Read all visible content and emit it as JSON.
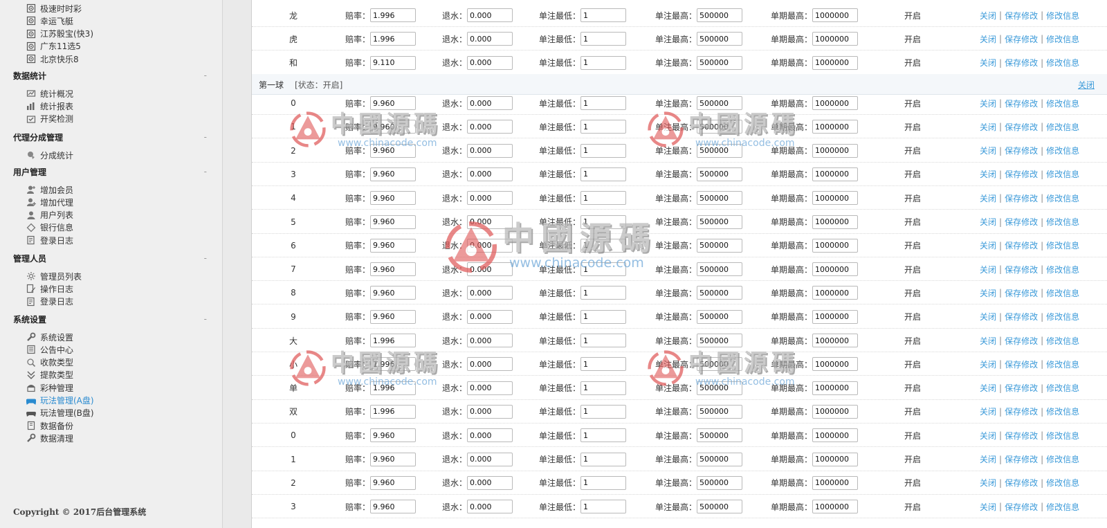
{
  "sidebar": {
    "top_items": [
      {
        "label": "极速时时彩",
        "icon": "lottery-icon"
      },
      {
        "label": "幸运飞艇",
        "icon": "lottery-icon"
      },
      {
        "label": "江苏骰宝(快3)",
        "icon": "lottery-icon"
      },
      {
        "label": "广东11选5",
        "icon": "lottery-icon"
      },
      {
        "label": "北京快乐8",
        "icon": "lottery-icon"
      }
    ],
    "sections": [
      {
        "title": "数据统计",
        "toggle": "-",
        "items": [
          {
            "label": "统计概况",
            "icon": "chart-icon"
          },
          {
            "label": "统计报表",
            "icon": "report-icon"
          },
          {
            "label": "开奖检测",
            "icon": "check-icon"
          }
        ]
      },
      {
        "title": "代理分成管理",
        "toggle": "-",
        "items": [
          {
            "label": "分成统计",
            "icon": "pie-icon"
          }
        ]
      },
      {
        "title": "用户管理",
        "toggle": "-",
        "items": [
          {
            "label": "增加会员",
            "icon": "add-user-icon"
          },
          {
            "label": "增加代理",
            "icon": "add-agent-icon"
          },
          {
            "label": "用户列表",
            "icon": "user-icon"
          },
          {
            "label": "银行信息",
            "icon": "bank-icon"
          },
          {
            "label": "登录日志",
            "icon": "log-icon"
          }
        ]
      },
      {
        "title": "管理人员",
        "toggle": "-",
        "items": [
          {
            "label": "管理员列表",
            "icon": "gear-icon"
          },
          {
            "label": "操作日志",
            "icon": "edit-log-icon"
          },
          {
            "label": "登录日志",
            "icon": "log-icon"
          }
        ]
      },
      {
        "title": "系统设置",
        "toggle": "-",
        "items": [
          {
            "label": "系统设置",
            "icon": "wrench-icon"
          },
          {
            "label": "公告中心",
            "icon": "notice-icon"
          },
          {
            "label": "收款类型",
            "icon": "receive-icon"
          },
          {
            "label": "提款类型",
            "icon": "withdraw-icon"
          },
          {
            "label": "彩种管理",
            "icon": "lottery-type-icon"
          },
          {
            "label": "玩法管理(A盘)",
            "icon": "gamepad-icon",
            "active": true
          },
          {
            "label": "玩法管理(B盘)",
            "icon": "gamepad-icon"
          },
          {
            "label": "数据备份",
            "icon": "backup-icon"
          },
          {
            "label": "数据清理",
            "icon": "wrench-icon"
          }
        ]
      }
    ],
    "copyright": "Copyright © 2017后台管理系统"
  },
  "labels": {
    "odds": "赔率：",
    "rebate": "退水：",
    "min_bet": "单注最低：",
    "max_bet": "单注最高：",
    "period_max": "单期最高：",
    "status_open": "开启",
    "op_close": "关闭",
    "op_save": "保存修改",
    "op_edit": "修改信息",
    "sep": "|"
  },
  "top_rows": [
    {
      "name": "龙",
      "odds": "1.996",
      "rebate": "0.000",
      "min": "1",
      "max": "500000",
      "period_max": "1000000",
      "status": "开启"
    },
    {
      "name": "虎",
      "odds": "1.996",
      "rebate": "0.000",
      "min": "1",
      "max": "500000",
      "period_max": "1000000",
      "status": "开启"
    },
    {
      "name": "和",
      "odds": "9.110",
      "rebate": "0.000",
      "min": "1",
      "max": "500000",
      "period_max": "1000000",
      "status": "开启"
    }
  ],
  "group": {
    "title": "第一球",
    "status": "[状态：开启]",
    "close": "关闭"
  },
  "group_rows": [
    {
      "name": "0",
      "odds": "9.960",
      "rebate": "0.000",
      "min": "1",
      "max": "500000",
      "period_max": "1000000",
      "status": "开启"
    },
    {
      "name": "1",
      "odds": "9.960",
      "rebate": "0.000",
      "min": "1",
      "max": "500000",
      "period_max": "1000000",
      "status": "开启"
    },
    {
      "name": "2",
      "odds": "9.960",
      "rebate": "0.000",
      "min": "1",
      "max": "500000",
      "period_max": "1000000",
      "status": "开启"
    },
    {
      "name": "3",
      "odds": "9.960",
      "rebate": "0.000",
      "min": "1",
      "max": "500000",
      "period_max": "1000000",
      "status": "开启"
    },
    {
      "name": "4",
      "odds": "9.960",
      "rebate": "0.000",
      "min": "1",
      "max": "500000",
      "period_max": "1000000",
      "status": "开启"
    },
    {
      "name": "5",
      "odds": "9.960",
      "rebate": "0.000",
      "min": "1",
      "max": "500000",
      "period_max": "1000000",
      "status": "开启"
    },
    {
      "name": "6",
      "odds": "9.960",
      "rebate": "0.000",
      "min": "1",
      "max": "500000",
      "period_max": "1000000",
      "status": "开启"
    },
    {
      "name": "7",
      "odds": "9.960",
      "rebate": "0.000",
      "min": "1",
      "max": "500000",
      "period_max": "1000000",
      "status": "开启"
    },
    {
      "name": "8",
      "odds": "9.960",
      "rebate": "0.000",
      "min": "1",
      "max": "500000",
      "period_max": "1000000",
      "status": "开启"
    },
    {
      "name": "9",
      "odds": "9.960",
      "rebate": "0.000",
      "min": "1",
      "max": "500000",
      "period_max": "1000000",
      "status": "开启"
    },
    {
      "name": "大",
      "odds": "1.996",
      "rebate": "0.000",
      "min": "1",
      "max": "500000",
      "period_max": "1000000",
      "status": "开启"
    },
    {
      "name": "小",
      "odds": "1.996",
      "rebate": "0.000",
      "min": "1",
      "max": "500000",
      "period_max": "1000000",
      "status": "开启"
    },
    {
      "name": "单",
      "odds": "1.996",
      "rebate": "0.000",
      "min": "1",
      "max": "500000",
      "period_max": "1000000",
      "status": "开启"
    },
    {
      "name": "双",
      "odds": "1.996",
      "rebate": "0.000",
      "min": "1",
      "max": "500000",
      "period_max": "1000000",
      "status": "开启"
    },
    {
      "name": "0",
      "odds": "9.960",
      "rebate": "0.000",
      "min": "1",
      "max": "500000",
      "period_max": "1000000",
      "status": "开启"
    },
    {
      "name": "1",
      "odds": "9.960",
      "rebate": "0.000",
      "min": "1",
      "max": "500000",
      "period_max": "1000000",
      "status": "开启"
    },
    {
      "name": "2",
      "odds": "9.960",
      "rebate": "0.000",
      "min": "1",
      "max": "500000",
      "period_max": "1000000",
      "status": "开启"
    },
    {
      "name": "3",
      "odds": "9.960",
      "rebate": "0.000",
      "min": "1",
      "max": "500000",
      "period_max": "1000000",
      "status": "开启"
    }
  ],
  "watermark": {
    "text": "中國源碼",
    "url": "www.chinacode.com"
  },
  "colors": {
    "link": "#3b9ad9",
    "active_nav": "#2a8bd0",
    "watermark_logo": "#e05a5a"
  }
}
